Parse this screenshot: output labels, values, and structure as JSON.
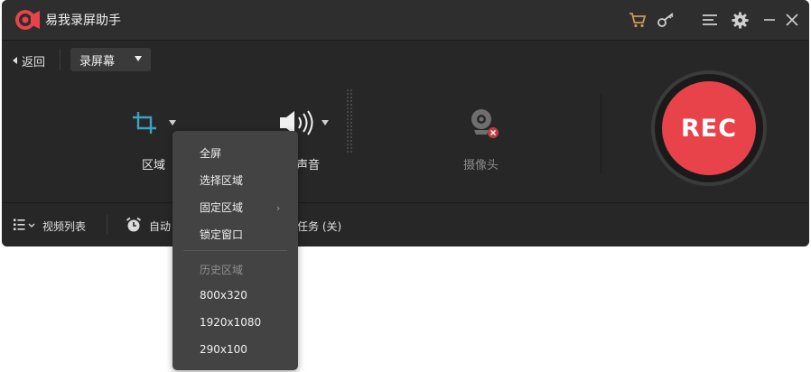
{
  "app": {
    "title": "易我录屏助手"
  },
  "toolbar": {
    "back_label": "返回",
    "mode_select_value": "录屏幕"
  },
  "features": {
    "region": {
      "label": "区域"
    },
    "sound": {
      "label_partial": "声音"
    },
    "camera": {
      "label": "摄像头"
    }
  },
  "rec_button": {
    "label": "REC"
  },
  "bottom": {
    "video_list_label": "视频列表",
    "auto_label_partial": "自动",
    "task_label_partial": "任务 (关)"
  },
  "region_menu": {
    "items": [
      "全屏",
      "选择区域",
      "固定区域",
      "锁定窗口"
    ],
    "history_header": "历史区域",
    "history_items": [
      "800x320",
      "1920x1080",
      "290x100"
    ]
  },
  "colors": {
    "accent_red": "#e8434a",
    "icon_teal": "#3aa3c4",
    "bg": "#272727"
  }
}
